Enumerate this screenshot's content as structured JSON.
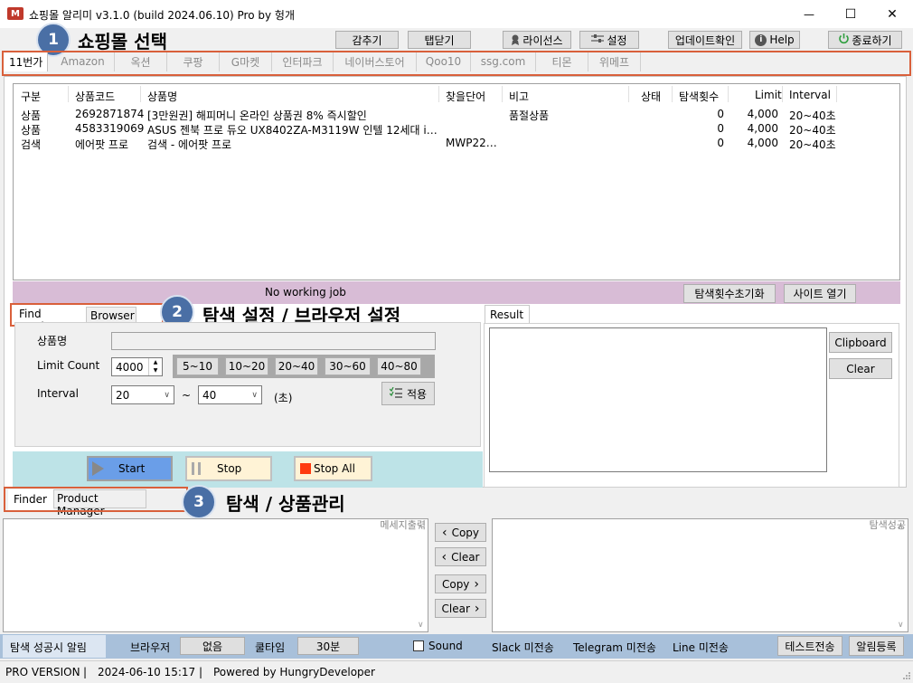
{
  "window": {
    "logo_text": "M",
    "title": "쇼핑몰 알리미 v3.1.0 (build 2024.06.10) Pro by 헝개",
    "min_glyph": "—",
    "max_glyph": "☐",
    "close_glyph": "✕"
  },
  "toolbar": {
    "hide": "감추기",
    "close_tab": "탭닫기",
    "license": "라이선스",
    "settings": "설정",
    "update": "업데이트확인",
    "help": "Help",
    "quit": "종료하기"
  },
  "annotations": {
    "one": {
      "num": "1",
      "text": "쇼핑몰 선택"
    },
    "two": {
      "num": "2",
      "text": "탐색 설정 / 브라우저 설정"
    },
    "three": {
      "num": "3",
      "text": "탐색 / 상품관리"
    }
  },
  "mall_tabs": [
    "11번가",
    "Amazon",
    "옥션",
    "쿠팡",
    "G마켓",
    "인터파크",
    "네이버스토어",
    "Qoo10",
    "ssg.com",
    "티몬",
    "위메프"
  ],
  "table": {
    "headers": [
      "구분",
      "상품코드",
      "상품명",
      "찾을단어",
      "비고",
      "상태",
      "탐색횟수",
      "Limit",
      "Interval"
    ],
    "rows": [
      [
        "상품",
        "2692871874",
        "[3만원권] 해피머니 온라인 상품권 8% 즉시할인",
        "",
        "품절상품",
        "",
        "0",
        "4,000",
        "20~40초"
      ],
      [
        "상품",
        "4583319069",
        "ASUS 젠북 프로 듀오 UX8402ZA-M3119W 인텔 12세대 i…",
        "",
        "",
        "",
        "0",
        "4,000",
        "20~40초"
      ],
      [
        "검색",
        "에어팟 프로",
        "검색 - 에어팟 프로",
        "MWP22…",
        "",
        "",
        "0",
        "4,000",
        "20~40초"
      ]
    ]
  },
  "status_bar": {
    "text": "No working job",
    "reset_count": "탐색횟수초기화",
    "open_site": "사이트 열기"
  },
  "settings_tabs": [
    "Find Setting",
    "Browser"
  ],
  "find_setting": {
    "product_name_label": "상품명",
    "product_name_value": "",
    "limit_label": "Limit Count",
    "limit_value": "4000",
    "limit_presets": [
      "5~10",
      "10~20",
      "20~40",
      "30~60",
      "40~80"
    ],
    "interval_label": "Interval",
    "interval_from": "20",
    "interval_tilde": "~",
    "interval_to": "40",
    "interval_unit": "(초)",
    "apply": "적용"
  },
  "controls": {
    "start": "Start",
    "stop": "Stop",
    "stop_all": "Stop All"
  },
  "result": {
    "tab": "Result",
    "clipboard": "Clipboard",
    "clear": "Clear"
  },
  "bottom_tabs": [
    "Finder",
    "Product Manager"
  ],
  "log": {
    "message_label": "메세지출력",
    "success_label": "탐색성공",
    "copy_left": "Copy",
    "clear_left": "Clear",
    "copy_right": "Copy",
    "clear_right": "Clear"
  },
  "alert_bar": {
    "success_alert": "탐색 성공시 알림",
    "browser_label": "브라우저",
    "browser_value": "없음",
    "cooltime_label": "쿨타임",
    "cooltime_value": "30분",
    "sound_label": "Sound",
    "slack": "Slack 미전송",
    "telegram": "Telegram 미전송",
    "line": "Line 미전송",
    "test_send": "테스트전송",
    "register_alert": "알림등록"
  },
  "footer": {
    "edition": "PRO VERSION",
    "sep1": "|",
    "datetime": "2024-06-10 15:17",
    "sep2": "|",
    "credit": "Powered by HungryDeveloper"
  }
}
